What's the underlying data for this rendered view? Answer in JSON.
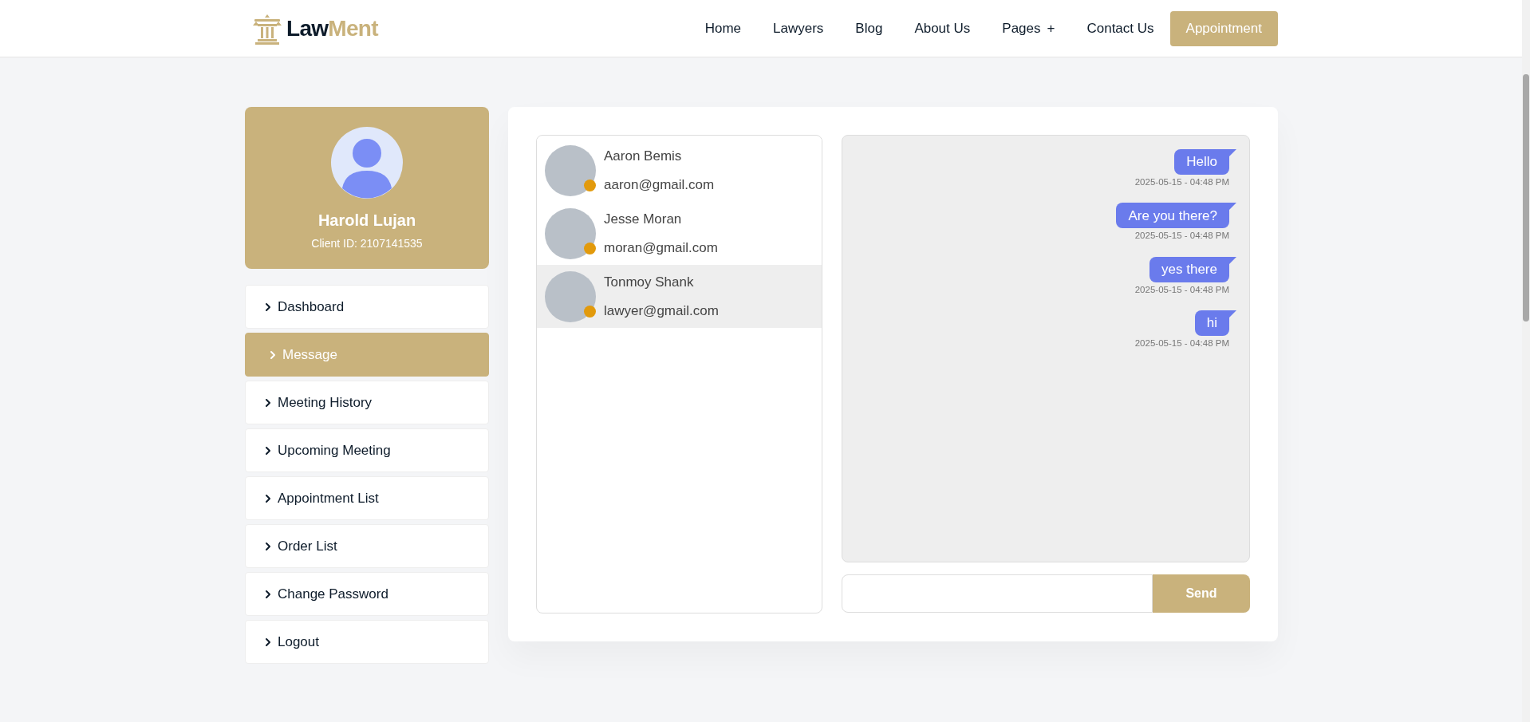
{
  "logo": {
    "dark": "Law",
    "gold": "Ment"
  },
  "nav": [
    {
      "label": "Home"
    },
    {
      "label": "Lawyers"
    },
    {
      "label": "Blog"
    },
    {
      "label": "About Us"
    },
    {
      "label": "Pages",
      "suffix": "+"
    },
    {
      "label": "Contact Us"
    }
  ],
  "cta": "Appointment",
  "profile": {
    "name": "Harold Lujan",
    "client_id": "Client ID: 2107141535"
  },
  "menu": [
    {
      "label": "Dashboard",
      "selected": false
    },
    {
      "label": "Message",
      "selected": true
    },
    {
      "label": "Meeting History",
      "selected": false
    },
    {
      "label": "Upcoming Meeting",
      "selected": false
    },
    {
      "label": "Appointment List",
      "selected": false
    },
    {
      "label": "Order List",
      "selected": false
    },
    {
      "label": "Change Password",
      "selected": false
    },
    {
      "label": "Logout",
      "selected": false
    }
  ],
  "contacts": [
    {
      "name": "Aaron Bemis",
      "email": "aaron@gmail.com",
      "selected": false
    },
    {
      "name": "Jesse Moran",
      "email": "moran@gmail.com",
      "selected": false
    },
    {
      "name": "Tonmoy Shank",
      "email": "lawyer@gmail.com",
      "selected": true
    }
  ],
  "messages": [
    {
      "text": "Hello",
      "time": "2025-05-15 - 04:48 PM"
    },
    {
      "text": "Are you there?",
      "time": "2025-05-15 - 04:48 PM"
    },
    {
      "text": "yes there",
      "time": "2025-05-15 - 04:48 PM"
    },
    {
      "text": "hi",
      "time": "2025-05-15 - 04:48 PM"
    }
  ],
  "send_button": "Send"
}
